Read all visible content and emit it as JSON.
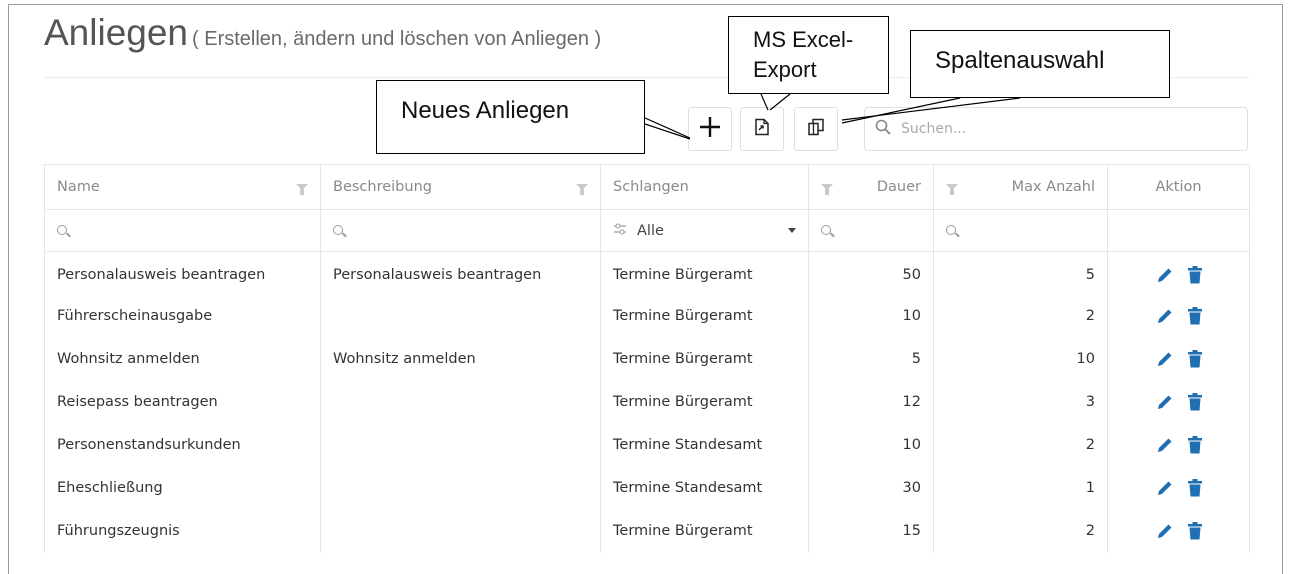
{
  "header": {
    "title": "Anliegen",
    "subtitle": "( Erstellen, ändern und löschen von Anliegen )"
  },
  "toolbar": {
    "add_icon": "plus-icon",
    "excel_icon": "file-export-icon",
    "columns_icon": "columns-icon",
    "search_placeholder": "Suchen..."
  },
  "callouts": {
    "new": "Neues Anliegen",
    "excel_line1": "MS Excel-",
    "excel_line2": "Export",
    "columns": "Spaltenauswahl"
  },
  "table": {
    "columns": [
      "Name",
      "Beschreibung",
      "Schlangen",
      "Dauer",
      "Max Anzahl",
      "Aktion"
    ],
    "queue_filter": "Alle",
    "rows": [
      {
        "name": "Personalausweis beantragen",
        "beschreibung": "Personalausweis beantragen",
        "schlange": "Termine Bürgeramt",
        "dauer": "50",
        "max": "5"
      },
      {
        "name": "Führerscheinausgabe",
        "beschreibung": "",
        "schlange": "Termine Bürgeramt",
        "dauer": "10",
        "max": "2"
      },
      {
        "name": "Wohnsitz anmelden",
        "beschreibung": "Wohnsitz anmelden",
        "schlange": "Termine Bürgeramt",
        "dauer": "5",
        "max": "10"
      },
      {
        "name": "Reisepass beantragen",
        "beschreibung": "",
        "schlange": "Termine Bürgeramt",
        "dauer": "12",
        "max": "3"
      },
      {
        "name": "Personenstandsurkunden",
        "beschreibung": "",
        "schlange": "Termine Standesamt",
        "dauer": "10",
        "max": "2"
      },
      {
        "name": "Eheschließung",
        "beschreibung": "",
        "schlange": "Termine Standesamt",
        "dauer": "30",
        "max": "1"
      },
      {
        "name": "Führungszeugnis",
        "beschreibung": "",
        "schlange": "Termine Bürgeramt",
        "dauer": "15",
        "max": "2"
      }
    ],
    "row_actions": [
      "pencil-icon",
      "trash-icon"
    ]
  },
  "colors": {
    "action_blue": "#1f6fb2"
  }
}
